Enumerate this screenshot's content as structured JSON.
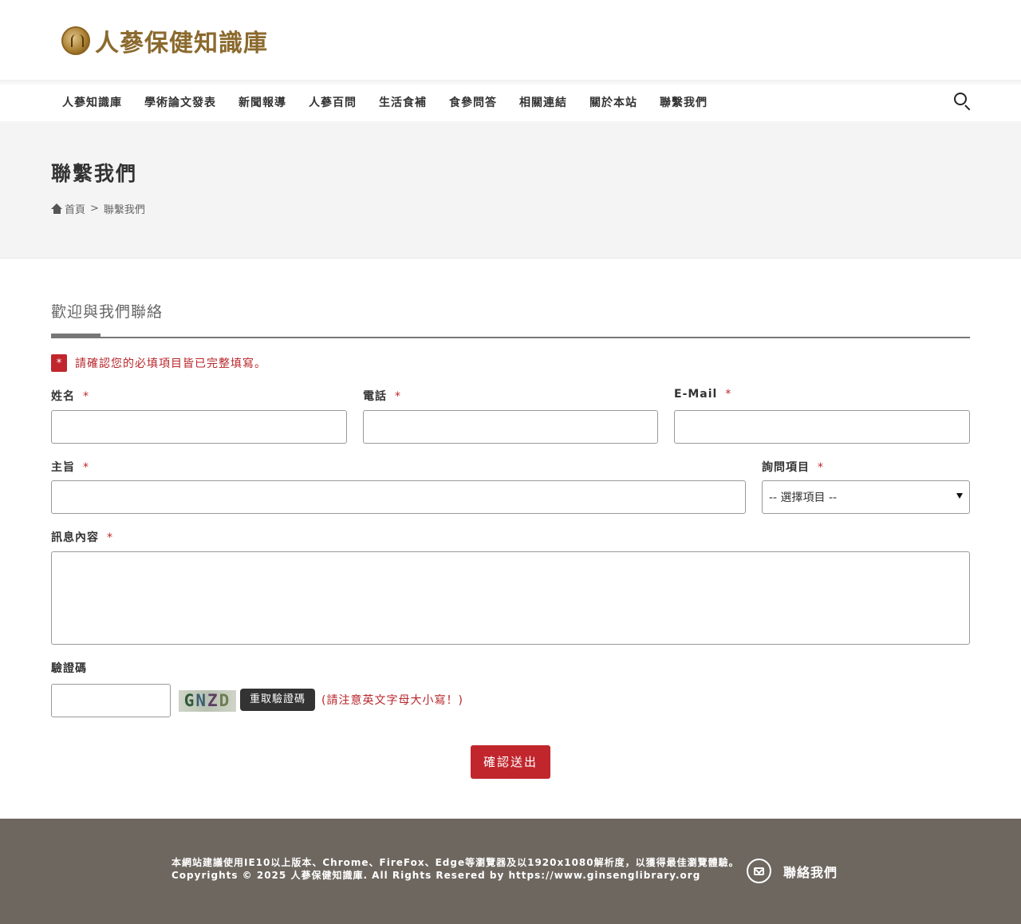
{
  "header": {
    "logo_text": "人蔘保健知識庫",
    "nav": [
      {
        "label": "人蔘知識庫"
      },
      {
        "label": "學術論文發表"
      },
      {
        "label": "新聞報導"
      },
      {
        "label": "人蔘百問"
      },
      {
        "label": "生活食補"
      },
      {
        "label": "食參問答"
      },
      {
        "label": "相關連結"
      },
      {
        "label": "關於本站"
      },
      {
        "label": "聯繫我們"
      }
    ]
  },
  "page": {
    "title": "聯繫我們",
    "breadcrumb": {
      "home": "首頁",
      "separator": ">",
      "current": "聯繫我們"
    }
  },
  "form": {
    "section_title": "歡迎與我們聯絡",
    "alert_badge": "*",
    "alert_text": "請確認您的必填項目皆已完整填寫。",
    "required_mark": "*",
    "fields": {
      "name": {
        "label": "姓名",
        "value": ""
      },
      "phone": {
        "label": "電話",
        "value": ""
      },
      "email": {
        "label": "E-Mail",
        "value": ""
      },
      "subject": {
        "label": "主旨",
        "value": ""
      },
      "inquiry": {
        "label": "詢問項目",
        "selected": "-- 選擇項目 --"
      },
      "message": {
        "label": "訊息內容",
        "value": ""
      },
      "captcha": {
        "label": "驗證碼",
        "value": ""
      }
    },
    "captcha_chars": [
      "G",
      "N",
      "Z",
      "D"
    ],
    "refresh_label": "重取驗證碼",
    "captcha_note": "(請注意英文字母大小寫！)",
    "submit_label": "確認送出"
  },
  "footer": {
    "line1": "本網站建議使用IE10以上版本、Chrome、FireFox、Edge等瀏覽器及以1920x1080解析度，以獲得最佳瀏覽體驗。",
    "line2": "Copyrights © 2025 人蔘保健知識庫. All Rights Resered by https://www.ginsenglibrary.org",
    "contact_label": "聯絡我們"
  },
  "colors": {
    "brand_gold": "#8b6a2e",
    "accent_red": "#c0262c",
    "footer_bg": "#6e6760"
  }
}
